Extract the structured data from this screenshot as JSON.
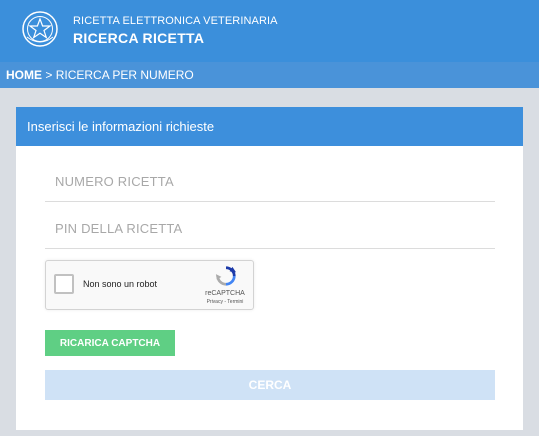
{
  "colors": {
    "header_bg": "#3b8fdb",
    "breadcrumb_bg": "#4a93d9",
    "card_header_bg": "#3d8fdc",
    "page_bg": "#d9dde3",
    "reload_button": "#5fcf84",
    "search_button_disabled": "#cfe2f6"
  },
  "header": {
    "logo_icon": "italian-republic-emblem-icon",
    "subtitle": "RICETTA ELETTRONICA VETERINARIA",
    "title": "RICERCA RICETTA"
  },
  "breadcrumb": {
    "home": "HOME",
    "separator": " > ",
    "current": "RICERCA PER NUMERO"
  },
  "card": {
    "title": "Inserisci le informazioni richieste",
    "fields": {
      "numero_placeholder": "NUMERO RICETTA",
      "numero_value": "",
      "pin_placeholder": "PIN DELLA RICETTA",
      "pin_value": ""
    },
    "captcha": {
      "checkbox_label": "Non sono un robot",
      "checked": false,
      "logo_icon": "recaptcha-logo-icon",
      "brand": "reCAPTCHA",
      "links": "Privacy - Termini"
    },
    "reload_button": "RICARICA CAPTCHA",
    "search_button": "CERCA"
  }
}
